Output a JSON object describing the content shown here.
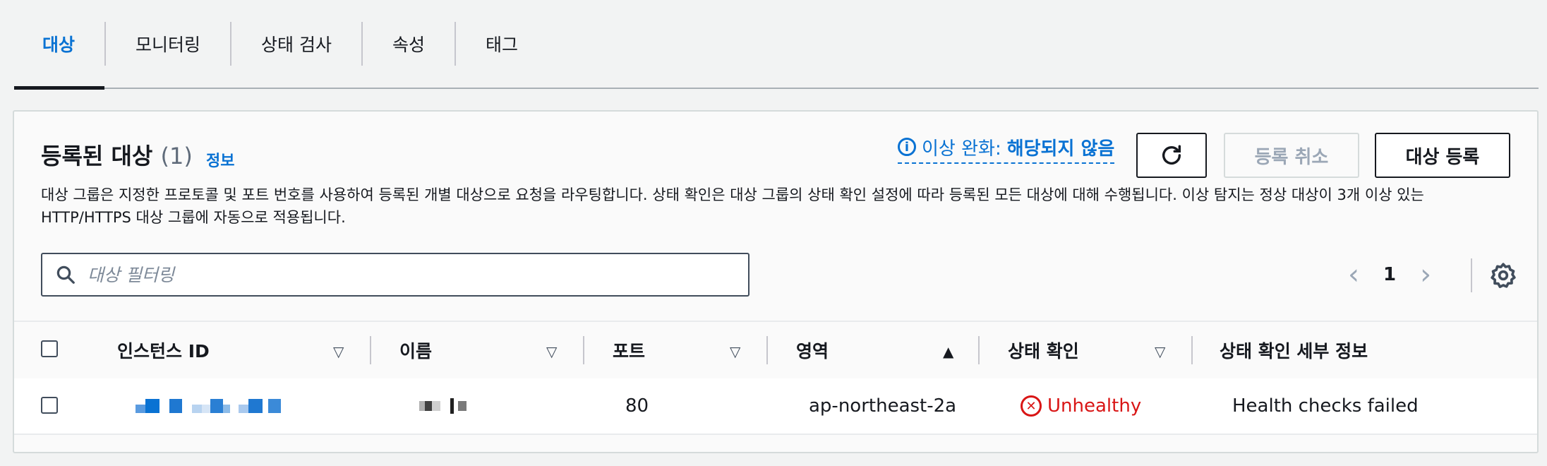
{
  "tabs": [
    {
      "label": "대상",
      "active": true
    },
    {
      "label": "모니터링",
      "active": false
    },
    {
      "label": "상태 검사",
      "active": false
    },
    {
      "label": "속성",
      "active": false
    },
    {
      "label": "태그",
      "active": false
    }
  ],
  "panel": {
    "title": "등록된 대상",
    "count": "(1)",
    "info_link": "정보",
    "anomaly_label": "이상 완화:",
    "anomaly_value": "해당되지 않음",
    "deregister_label": "등록 취소",
    "register_label": "대상 등록",
    "description": "대상 그룹은 지정한 프로토콜 및 포트 번호를 사용하여 등록된 개별 대상으로 요청을 라우팅합니다. 상태 확인은 대상 그룹의 상태 확인 설정에 따라 등록된 모든 대상에 대해 수행됩니다. 이상 탐지는 정상 대상이 3개 이상 있는 HTTP/HTTPS 대상 그룹에 자동으로 적용됩니다."
  },
  "filter": {
    "placeholder": "대상 필터링"
  },
  "pagination": {
    "current_page": "1"
  },
  "table": {
    "columns": [
      "인스턴스 ID",
      "이름",
      "포트",
      "영역",
      "상태 확인",
      "상태 확인 세부 정보"
    ],
    "sorted_column": "영역",
    "rows": [
      {
        "port": "80",
        "zone": "ap-northeast-2a",
        "health": "Unhealthy",
        "health_details": "Health checks failed"
      }
    ]
  },
  "colors": {
    "link": "#0972d3",
    "error": "#d91515",
    "text": "#16191f",
    "disabled": "#9ba7b6"
  },
  "icons": [
    "info-icon",
    "refresh-icon",
    "search-icon",
    "chevron-left-icon",
    "chevron-right-icon",
    "settings-icon",
    "sort-icon",
    "error-icon"
  ]
}
